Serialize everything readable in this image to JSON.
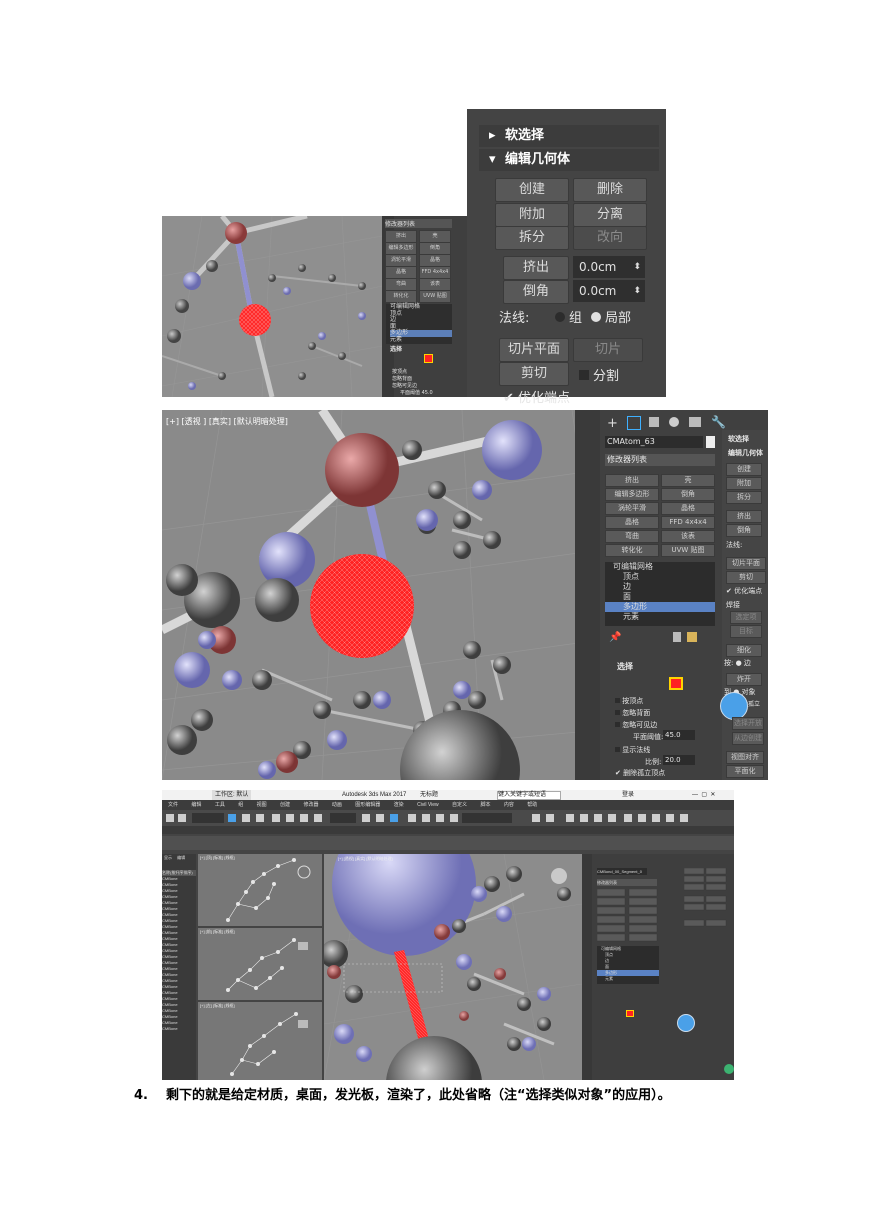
{
  "shot1": {
    "rollouts": {
      "soft_select": "软选择",
      "edit_geometry": "编辑几何体"
    },
    "buttons": {
      "create": "创建",
      "delete": "删除",
      "attach": "附加",
      "detach": "分离",
      "split": "拆分",
      "turn": "改向",
      "extrude": "挤出",
      "chamfer": "倒角",
      "slice_plane": "切片平面",
      "slice": "切片",
      "cut": "剪切",
      "split_check": "分割"
    },
    "extrude_value": "0.0cm",
    "chamfer_value": "0.0cm",
    "normal_label": "法线:",
    "radio_group": "组",
    "radio_local": "局部",
    "optimize_end": "优化端点",
    "small_panel": {
      "modifier_list": "修改器列表",
      "buttons": [
        "挤出",
        "壳",
        "编辑多边形",
        "倒角",
        "涡轮平滑",
        "晶格",
        "晶格",
        "FFD 4x4x4",
        "弯曲",
        "该表",
        "转化化",
        "UVW 贴图"
      ],
      "stack": [
        "可编辑网格",
        "顶点",
        "边",
        "面",
        "多边形",
        "元素"
      ],
      "select_title": "选择",
      "options": [
        "按顶点",
        "忽略背面",
        "忽略可见边",
        "平面阈值 45.0"
      ]
    }
  },
  "shot2": {
    "viewport_label": "[+] [透视 ] [真实] [默认明暗处理]",
    "object_name": "CMAtom_63",
    "modifier_list": "修改器列表",
    "buttons": [
      "挤出",
      "壳",
      "编辑多边形",
      "倒角",
      "涡轮平滑",
      "晶格",
      "晶格",
      "FFD 4x4x4",
      "弯曲",
      "该表",
      "转化化",
      "UVW 贴图"
    ],
    "stack": [
      "可编辑网格",
      "顶点",
      "边",
      "面",
      "多边形",
      "元素"
    ],
    "select_title": "选择",
    "select_options": [
      "按顶点",
      "忽略背面",
      "忽略可见边",
      "平面阈值:",
      "显示法线",
      "比例:",
      "删除孤立顶点"
    ],
    "plane_threshold": "45.0",
    "scale": "20.0",
    "right_panel": {
      "soft_select": "软选择",
      "edit_geometry": "编辑几何体",
      "buttons": [
        "创建",
        "附加",
        "拆分",
        "挤出",
        "倒角"
      ],
      "normal": "法线:",
      "slice_plane": "切片平面",
      "cut": "剪切",
      "optimize": "优化端点",
      "weld": "焊接",
      "selected": "选定项",
      "target": "目标",
      "refine": "细化",
      "by": "按: ● 边",
      "explode": "炸开",
      "to_object": "到 ● 对象",
      "remove_isolated": "移除孤立",
      "select_open": "选择开放",
      "create_shape": "从边创建",
      "view_align": "视图对齐",
      "flatten": "平面化"
    }
  },
  "shot3": {
    "app_title": "Autodesk 3ds Max 2017",
    "doc_title": "无标题",
    "workspace": "工作区: 默认",
    "search_placeholder": "键入关键字或短语",
    "user": "登录",
    "menus": [
      "文件",
      "编辑",
      "工具",
      "组",
      "视图",
      "创建",
      "修改器",
      "动画",
      "图形编辑器",
      "渲染",
      "Civil View",
      "自定义",
      "脚本",
      "内容",
      "帮助"
    ],
    "scene_tabs": [
      "显示",
      "编辑"
    ],
    "scene_header": "名称(按升序排序)",
    "scene_items": [
      "CMBone",
      "CMBone",
      "CMBone",
      "CMBone",
      "CMBone",
      "CMBone",
      "CMBone",
      "CMBone",
      "CMBone",
      "CMBone",
      "CMBone",
      "CMBone",
      "CMBone",
      "CMBone",
      "CMBone",
      "CMBone",
      "CMBone",
      "CMBone",
      "CMBone",
      "CMBone",
      "CMBone",
      "CMBone",
      "CMBone",
      "CMBone",
      "CMBone",
      "CMBone"
    ],
    "viewport_top": "[+] [顶] [标准] [线框]",
    "viewport_front": "[+] [前] [标准] [线框]",
    "viewport_left": "[+] [左] [标准] [线框]",
    "viewport_persp": "[+] [透视] [真实] [默认明暗处理]",
    "object_name": "CMBond_00_Segment_0",
    "modifier_list": "修改器列表",
    "stack": [
      "可编辑网格",
      "顶点",
      "边",
      "面",
      "多边形",
      "元素"
    ]
  },
  "caption": {
    "number": "4.",
    "text": "剩下的就是给定材质，桌面，发光板，渲染了，此处省略（注“选择类似对象”的应用）。"
  },
  "colors": {
    "panel": "#444444",
    "atom_red": "#b95858",
    "atom_blue": "#9fa0d6",
    "atom_gray": "#6b6b6b",
    "selection_red": "#ff2a2a",
    "viewport_bg": "#8d8d8d"
  }
}
